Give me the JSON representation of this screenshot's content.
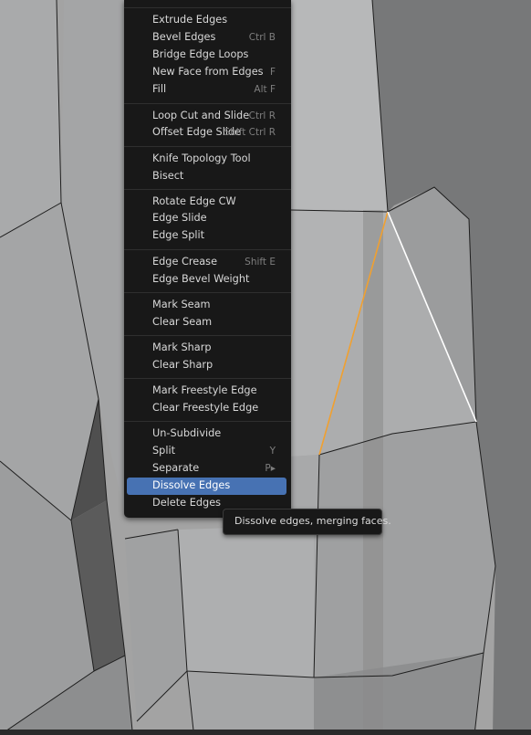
{
  "menu": {
    "items": [
      {
        "label": "Extrude Edges",
        "shortcut": "",
        "highlighted": false
      },
      {
        "label": "Bevel Edges",
        "shortcut": "Ctrl B",
        "highlighted": false
      },
      {
        "label": "Bridge Edge Loops",
        "shortcut": "",
        "highlighted": false
      },
      {
        "label": "New Face from Edges",
        "shortcut": "F",
        "highlighted": false
      },
      {
        "label": "Fill",
        "shortcut": "Alt F",
        "highlighted": false
      },
      {
        "label": "Loop Cut and Slide",
        "shortcut": "Ctrl R",
        "highlighted": false
      },
      {
        "label": "Offset Edge Slide",
        "shortcut": "Shift Ctrl R",
        "highlighted": false
      },
      {
        "label": "Knife Topology Tool",
        "shortcut": "",
        "highlighted": false
      },
      {
        "label": "Bisect",
        "shortcut": "",
        "highlighted": false
      },
      {
        "label": "Rotate Edge CW",
        "shortcut": "",
        "highlighted": false
      },
      {
        "label": "Edge Slide",
        "shortcut": "",
        "highlighted": false
      },
      {
        "label": "Edge Split",
        "shortcut": "",
        "highlighted": false
      },
      {
        "label": "Edge Crease",
        "shortcut": "Shift E",
        "highlighted": false
      },
      {
        "label": "Edge Bevel Weight",
        "shortcut": "",
        "highlighted": false
      },
      {
        "label": "Mark Seam",
        "shortcut": "",
        "highlighted": false
      },
      {
        "label": "Clear Seam",
        "shortcut": "",
        "highlighted": false
      },
      {
        "label": "Mark Sharp",
        "shortcut": "",
        "highlighted": false
      },
      {
        "label": "Clear Sharp",
        "shortcut": "",
        "highlighted": false
      },
      {
        "label": "Mark Freestyle Edge",
        "shortcut": "",
        "highlighted": false
      },
      {
        "label": "Clear Freestyle Edge",
        "shortcut": "",
        "highlighted": false
      },
      {
        "label": "Un-Subdivide",
        "shortcut": "",
        "highlighted": false
      },
      {
        "label": "Split",
        "shortcut": "Y",
        "highlighted": false
      },
      {
        "label": "Separate",
        "shortcut": "P▸",
        "highlighted": false
      },
      {
        "label": "Dissolve Edges",
        "shortcut": "",
        "highlighted": true
      },
      {
        "label": "Delete Edges",
        "shortcut": "",
        "highlighted": false
      }
    ]
  },
  "tooltip": {
    "text": "Dissolve edges, merging faces."
  },
  "colors": {
    "menu_bg": "#181818",
    "highlight": "#4772b3",
    "selected_edge": "#f0a030",
    "active_edge": "#ffffff"
  }
}
